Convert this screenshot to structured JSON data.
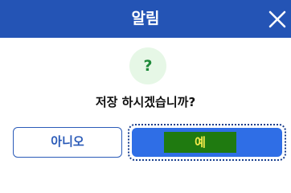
{
  "dialog": {
    "title": "알림",
    "message": "저장 하시겠습니까?",
    "question_icon_glyph": "?",
    "buttons": {
      "no_label": "아니오",
      "yes_label": "예"
    }
  },
  "colors": {
    "titlebar": "#2454b5",
    "primary_button": "#2f6ee6",
    "icon_background": "#e6f7e6",
    "icon_glyph": "#1f8a3a"
  },
  "icons": {
    "close": "close-icon",
    "question": "question-icon"
  }
}
